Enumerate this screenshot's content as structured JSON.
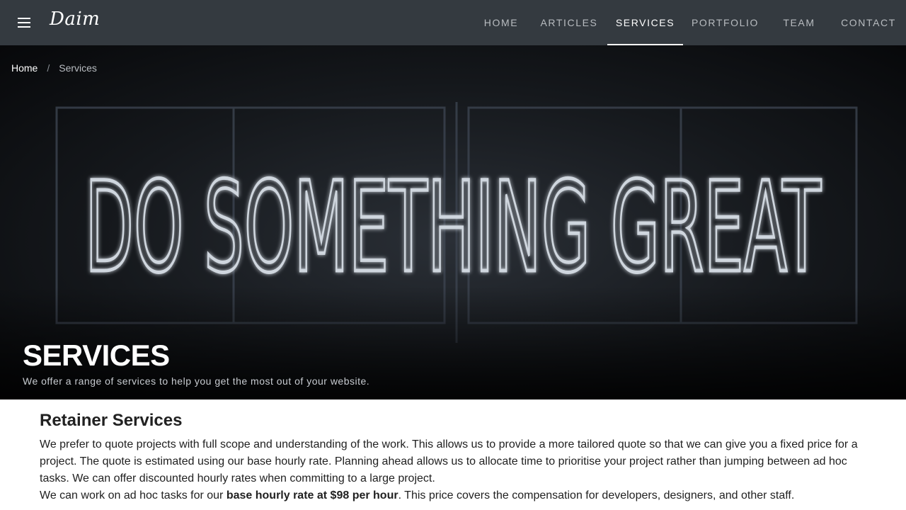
{
  "appbar": {
    "brand": "Daim",
    "nav": [
      {
        "label": "Home",
        "active": false
      },
      {
        "label": "Articles",
        "active": false
      },
      {
        "label": "Services",
        "active": true
      },
      {
        "label": "Portfolio",
        "active": false
      },
      {
        "label": "Team",
        "active": false
      },
      {
        "label": "Contact",
        "active": false
      }
    ]
  },
  "breadcrumb": {
    "home": "Home",
    "separator": "/",
    "current": "Services"
  },
  "hero": {
    "neon_text": "DO SOMETHING GREAT",
    "title": "SERVICES",
    "subtitle": "We offer a range of services to help you get the most out of your website."
  },
  "content": {
    "section_title": "Retainer Services",
    "paragraph1": "We prefer to quote projects with full scope and understanding of the work. This allows us to provide a more tailored quote so that we can give you a fixed price for a project. The quote is estimated using our base hourly rate. Planning ahead allows us to allocate time to prioritise your project rather than jumping between ad hoc tasks. We can offer discounted hourly rates when committing to a large project.",
    "paragraph2_prefix": "We can work on ad hoc tasks for our ",
    "paragraph2_bold": "base hourly rate at $98 per hour",
    "paragraph2_suffix": ". This price covers the compensation for developers, designers, and other staff."
  },
  "colors": {
    "appbar_bg": "#343a40",
    "nav_text": "#b8bcc0",
    "nav_active": "#ffffff",
    "hero_bg": "#0c0e11",
    "text": "#212121"
  }
}
